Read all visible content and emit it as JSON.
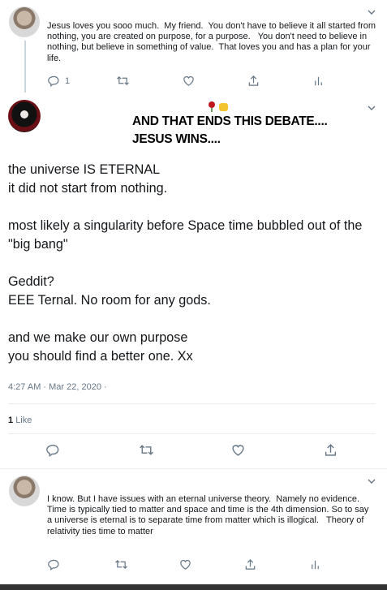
{
  "tweet1": {
    "text": "Jesus loves you sooo much.  My friend.  You don't have to believe it all started from nothing, you are created on purpose, for a purpose.   You don't need to believe in nothing, but believe in something of value.  That loves you and has a plan for your life.",
    "reply_count": "1"
  },
  "tweet2": {
    "meme_text": "AND THAT ENDS THIS DEBATE....\nJESUS WINS....",
    "body": "the universe IS ETERNAL\nit did not start from nothing.\n\nmost likely a singularity before Space time bubbled out of the \"big bang\"\n\nGeddit?\nEEE Ternal. No room for any gods.\n\nand we make our own purpose\nyou should find a better one. Xx",
    "timestamp": "4:27 AM · Mar 22, 2020 ·",
    "like_count": "1",
    "like_label": "Like"
  },
  "tweet3": {
    "text": "I know. But I have issues with an eternal universe theory.  Namely no evidence. Time is typically tied to matter and space and time is the 4th dimension. So to say a universe is eternal is to separate time from matter which is illogical.   Theory of relativity ties time to matter"
  },
  "icons": [
    "reply-icon",
    "retweet-icon",
    "like-icon",
    "share-icon",
    "analytics-icon",
    "chevron-down-icon",
    "rose-emoji",
    "fist-emoji"
  ],
  "colors": {
    "icon_gray": "#657786",
    "text": "#14171a",
    "border": "#e6ecf0"
  }
}
